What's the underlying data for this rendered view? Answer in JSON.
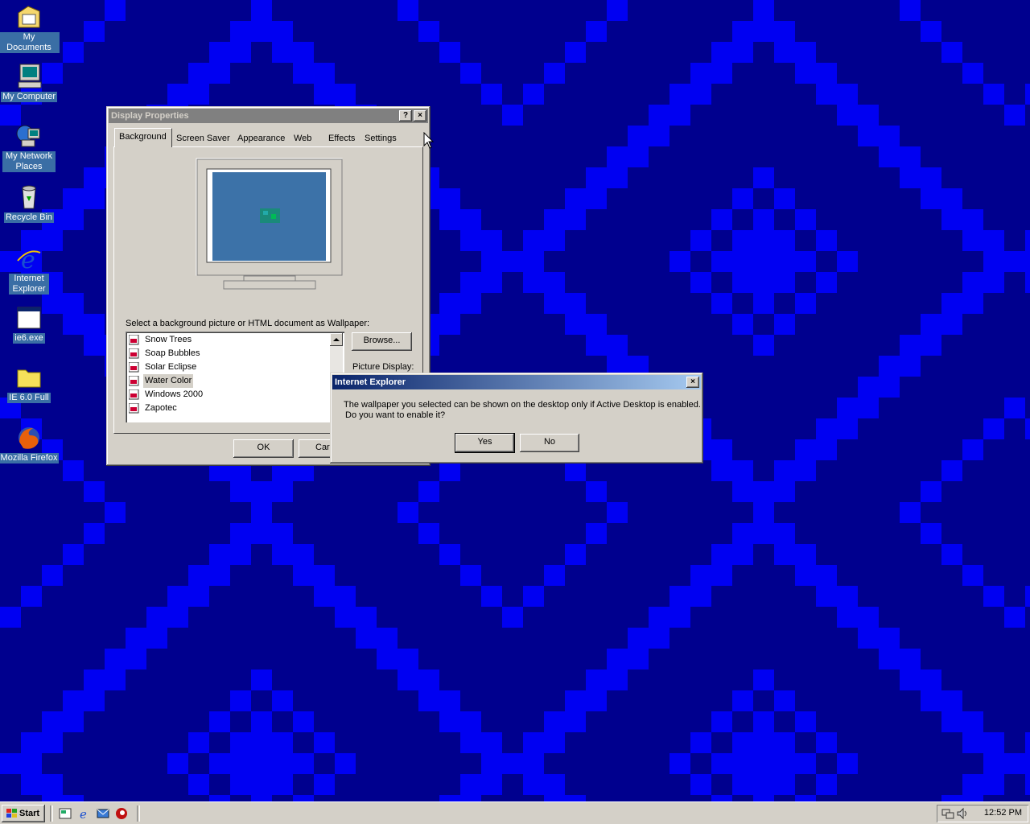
{
  "desktop": {
    "colors": {
      "dark": "#00008e",
      "light": "#0000f2"
    },
    "icons": [
      {
        "label": "My Documents",
        "icon": "my-documents-icon"
      },
      {
        "label": "My Computer",
        "icon": "my-computer-icon"
      },
      {
        "label": "My Network Places",
        "icon": "network-places-icon"
      },
      {
        "label": "Recycle Bin",
        "icon": "recycle-bin-icon"
      },
      {
        "label": "Internet Explorer",
        "icon": "internet-explorer-icon"
      },
      {
        "label": "ie6.exe",
        "icon": "setup-exe-icon"
      },
      {
        "label": "IE 6.0 Full",
        "icon": "folder-icon"
      },
      {
        "label": "Mozilla Firefox",
        "icon": "firefox-icon"
      }
    ]
  },
  "display_properties": {
    "title": "Display Properties",
    "help_btn": "?",
    "close_btn": "×",
    "tabs": [
      "Background",
      "Screen Saver",
      "Appearance",
      "Web",
      "Effects",
      "Settings"
    ],
    "selected_tab": "Background",
    "wallpaper_prompt": "Select a background picture or HTML document as Wallpaper:",
    "wallpapers": [
      "Snow Trees",
      "Soap Bubbles",
      "Solar Eclipse",
      "Water Color",
      "Windows 2000",
      "Zapotec"
    ],
    "selected_wallpaper": "Water Color",
    "browse_label": "Browse...",
    "picture_display_label": "Picture Display:",
    "ok_label": "OK",
    "cancel_label": "Car"
  },
  "ie_dialog": {
    "title": "Internet Explorer",
    "close_btn": "×",
    "message_line1": "The wallpaper you selected can be shown on the desktop only if Active Desktop is enabled.",
    "message_line2": "Do you want to enable it?",
    "yes_label": "Yes",
    "no_label": "No"
  },
  "taskbar": {
    "start_label": "Start",
    "quick_launch": [
      "show-desktop-icon",
      "internet-explorer-icon",
      "outlook-express-icon",
      "firefox-icon"
    ],
    "clock": "12:52 PM"
  }
}
